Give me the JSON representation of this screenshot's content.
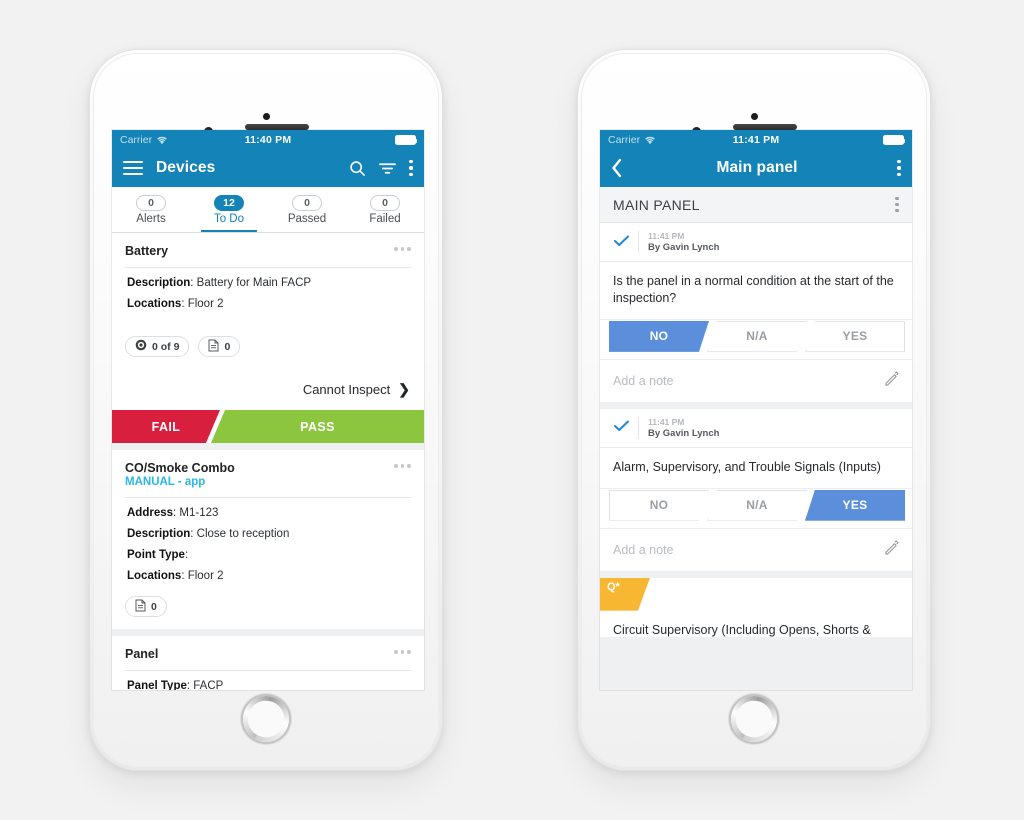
{
  "phones": {
    "left": {
      "status_bar": {
        "carrier": "Carrier",
        "wifi_icon": "wifi-icon",
        "time": "11:40 PM",
        "battery_icon": "battery-full-icon"
      },
      "app_bar": {
        "menu_icon": "hamburger-menu-icon",
        "title": "Devices",
        "search_icon": "search-icon",
        "filter_icon": "filter-icon",
        "overflow_icon": "more-vertical-icon"
      },
      "tabs": [
        {
          "count": "0",
          "label": "Alerts",
          "active": false
        },
        {
          "count": "12",
          "label": "To Do",
          "active": true
        },
        {
          "count": "0",
          "label": "Passed",
          "active": false
        },
        {
          "count": "0",
          "label": "Failed",
          "active": false
        }
      ],
      "cards": [
        {
          "title": "Battery",
          "subtitle": "",
          "fields": [
            {
              "label": "Description",
              "value": "Battery for Main FACP"
            },
            {
              "label": "Locations",
              "value": "Floor 2"
            }
          ],
          "chips": [
            {
              "icon": "target-icon",
              "text": "0 of 9"
            },
            {
              "icon": "document-icon",
              "text": "0"
            }
          ]
        },
        {
          "title": "CO/Smoke Combo",
          "subtitle": "MANUAL - app",
          "fields": [
            {
              "label": "Address",
              "value": "M1-123"
            },
            {
              "label": "Description",
              "value": "Close to reception"
            },
            {
              "label": "Point Type",
              "value": ""
            },
            {
              "label": "Locations",
              "value": "Floor 2"
            }
          ],
          "chips": [
            {
              "icon": "document-icon",
              "text": "0"
            }
          ]
        },
        {
          "title": "Panel",
          "subtitle": "",
          "fields": [
            {
              "label": "Panel Type",
              "value": "FACP"
            }
          ],
          "chips": []
        }
      ],
      "cannot_inspect": {
        "label": "Cannot Inspect",
        "chevron": "❯"
      },
      "verdict": {
        "fail": "FAIL",
        "pass": "PASS"
      },
      "overflow_icon": "more-horizontal-icon"
    },
    "right": {
      "status_bar": {
        "carrier": "Carrier",
        "wifi_icon": "wifi-icon",
        "time": "11:41 PM",
        "battery_icon": "battery-full-icon"
      },
      "app_bar": {
        "back_icon": "chevron-left-icon",
        "title": "Main panel",
        "overflow_icon": "more-vertical-icon"
      },
      "section": {
        "title": "MAIN PANEL",
        "overflow_icon": "more-vertical-icon"
      },
      "questions": [
        {
          "check_icon": "checkmark-icon",
          "time": "11:41 PM",
          "author": "By Gavin Lynch",
          "text": "Is the panel in a normal condition at the start of the inspection?",
          "answers": [
            {
              "label": "NO",
              "selected": true
            },
            {
              "label": "N/A",
              "selected": false
            },
            {
              "label": "YES",
              "selected": false
            }
          ],
          "note_placeholder": "Add a note",
          "note_icon": "pencil-icon"
        },
        {
          "check_icon": "checkmark-icon",
          "time": "11:41 PM",
          "author": "By Gavin Lynch",
          "text": "Alarm, Supervisory, and Trouble Signals (Inputs)",
          "answers": [
            {
              "label": "NO",
              "selected": false
            },
            {
              "label": "N/A",
              "selected": false
            },
            {
              "label": "YES",
              "selected": true
            }
          ],
          "note_placeholder": "Add a note",
          "note_icon": "pencil-icon"
        }
      ],
      "tag": {
        "label": "Q*"
      },
      "cut_off_text": "Circuit Supervisory (Including Opens, Shorts &"
    }
  },
  "colors": {
    "header_blue": "#1483b8",
    "accent_blue": "#5b8fdb",
    "fail_red": "#d8203e",
    "pass_green": "#8cc63f",
    "tag_yellow": "#f7b732",
    "link_cyan": "#29b6e8",
    "page_bg": "#f2f2f2"
  }
}
